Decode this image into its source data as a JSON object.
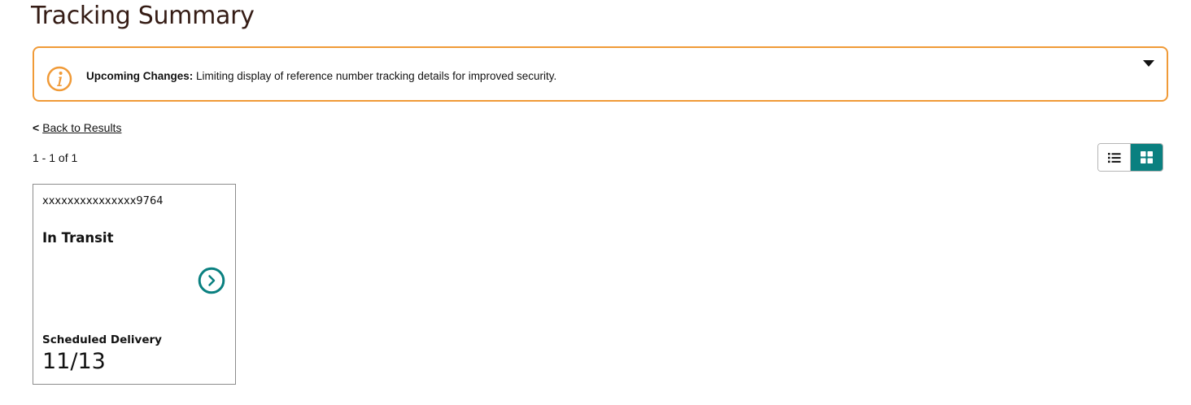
{
  "page": {
    "title": "Tracking Summary"
  },
  "alert": {
    "label": "Upcoming Changes:",
    "message": "Limiting display of reference number tracking details for improved security.",
    "icon": "info-icon",
    "toggle_icon": "caret-down-icon",
    "accent_color": "#f09a37"
  },
  "nav": {
    "back_chevron": "<",
    "back_label": "Back to Results"
  },
  "results": {
    "range": "1 - 1 of 1"
  },
  "view_toggle": {
    "options": [
      "list-view-icon",
      "grid-view-icon"
    ],
    "selected": "grid-view-icon",
    "active_color": "#0a8080"
  },
  "shipments": [
    {
      "tracking_number": "xxxxxxxxxxxxxxx9764",
      "status": "In Transit",
      "delivery_label": "Scheduled Delivery",
      "delivery_date": "11/13",
      "action_icon": "chevron-right-circle-icon"
    }
  ]
}
